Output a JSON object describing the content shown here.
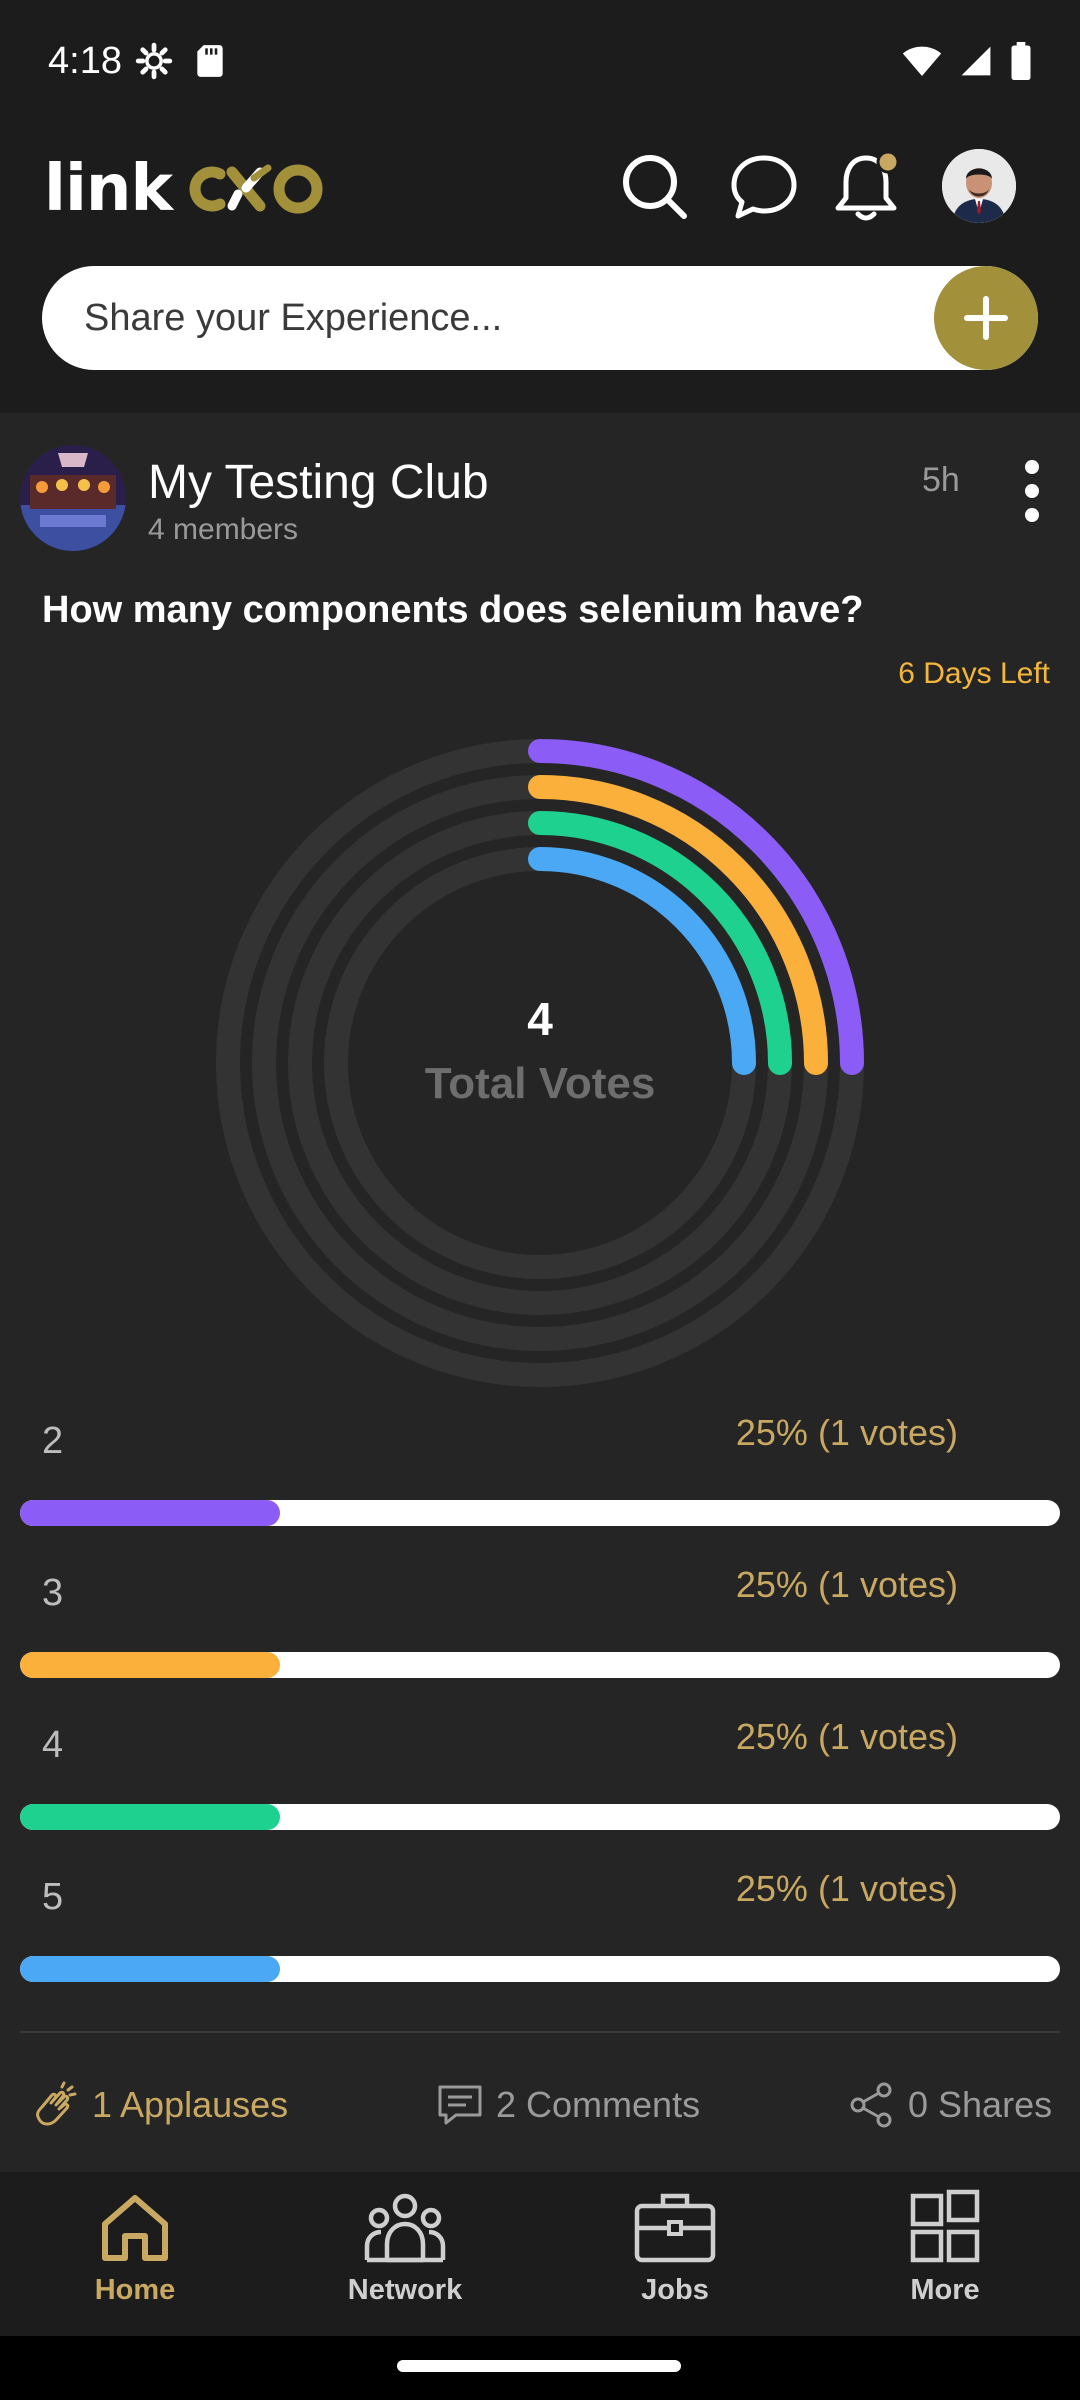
{
  "status_bar": {
    "time": "4:18",
    "icons": [
      "settings-icon",
      "sd-card-icon",
      "wifi-icon",
      "signal-icon",
      "battery-icon"
    ]
  },
  "header": {
    "logo_link": "link",
    "logo_cxo": "CXO",
    "icons": [
      "search-icon",
      "chat-icon",
      "bell-icon",
      "avatar"
    ],
    "accent_color": "#a2913a"
  },
  "composer": {
    "placeholder": "Share your Experience..."
  },
  "post": {
    "club_name": "My Testing Club",
    "members": "4 members",
    "time_ago": "5h",
    "question": "How many components does selenium have?",
    "days_left": "6 Days Left",
    "total_votes_value": "4",
    "total_votes_label": "Total Votes",
    "options": [
      {
        "label": "2",
        "result": "25% (1 votes)",
        "percent": 25,
        "color": "#8b5cf6"
      },
      {
        "label": "3",
        "result": "25% (1 votes)",
        "percent": 25,
        "color": "#fbb03b"
      },
      {
        "label": "4",
        "result": "25% (1 votes)",
        "percent": 25,
        "color": "#1fd18f"
      },
      {
        "label": "5",
        "result": "25% (1 votes)",
        "percent": 25,
        "color": "#4aa8f5"
      }
    ],
    "actions": {
      "applauses": "1 Applauses",
      "comments": "2 Comments",
      "shares": "0 Shares"
    }
  },
  "bottom_nav": {
    "items": [
      {
        "label": "Home",
        "icon": "home-icon",
        "active": true
      },
      {
        "label": "Network",
        "icon": "network-icon",
        "active": false
      },
      {
        "label": "Jobs",
        "icon": "briefcase-icon",
        "active": false
      },
      {
        "label": "More",
        "icon": "grid-icon",
        "active": false
      }
    ],
    "active_color": "#c9a862",
    "inactive_color": "#cfcfcf"
  }
}
